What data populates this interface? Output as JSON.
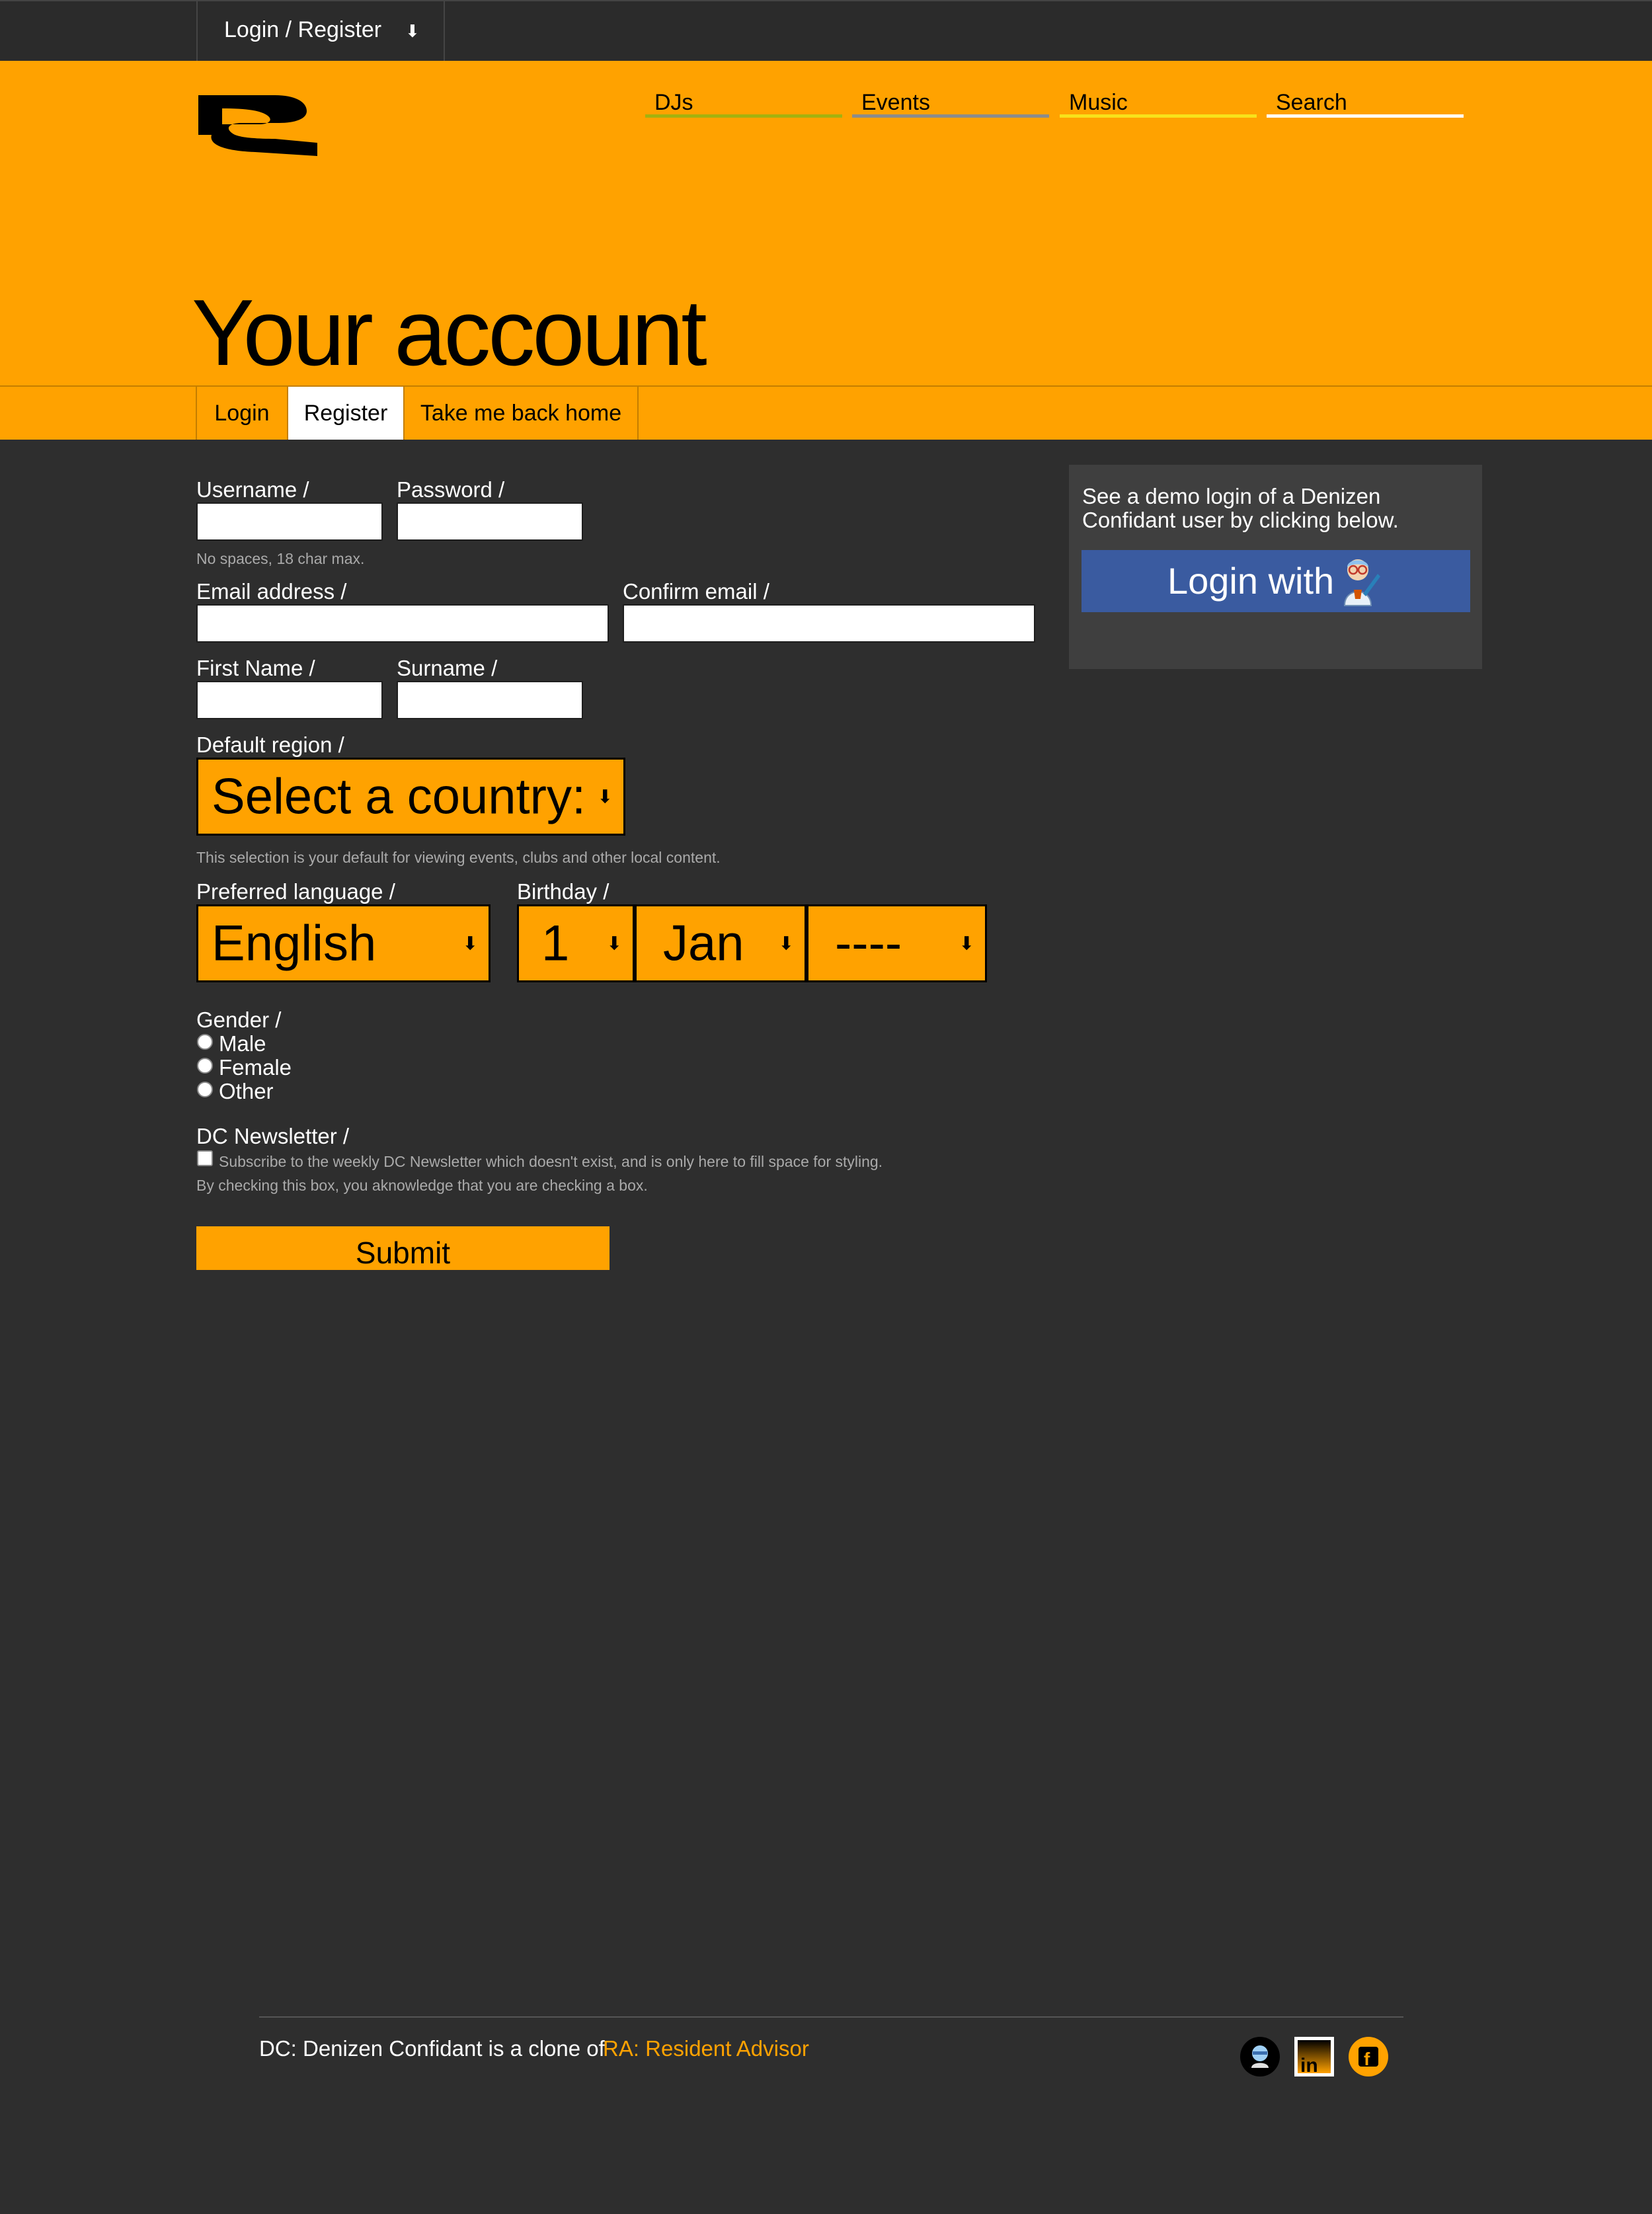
{
  "topbar": {
    "login_label": "Login / Register",
    "arrow": "⬇"
  },
  "nav": {
    "djs": "DJs",
    "events": "Events",
    "music": "Music",
    "search": "Search"
  },
  "colors": {
    "accent": "#ffa200",
    "djs_underline": "#a4b20e",
    "events_underline": "#8c8c8c",
    "music_underline": "#f7e21a",
    "search_underline": "#ffffff",
    "facebook_button": "#3a5ba0"
  },
  "page_title": "Your account",
  "tabs": {
    "login": "Login",
    "register": "Register",
    "home": "Take me back home"
  },
  "form": {
    "username_label": "Username /",
    "password_label": "Password /",
    "username_hint": "No spaces, 18 char max.",
    "email_label": "Email address /",
    "confirm_email_label": "Confirm email /",
    "first_name_label": "First Name /",
    "surname_label": "Surname /",
    "region_label": "Default region /",
    "region_value": "Select a country:",
    "region_hint": "This selection is your default for viewing events, clubs and other local content.",
    "language_label": "Preferred language /",
    "language_value": "English",
    "birthday_label": "Birthday /",
    "birthday_day": "1",
    "birthday_month": "Jan",
    "birthday_year": "----",
    "gender_label": "Gender /",
    "gender_male": "Male",
    "gender_female": "Female",
    "gender_other": "Other",
    "newsletter_label": "DC Newsletter /",
    "newsletter_text": "Subscribe to the weekly DC Newsletter which doesn't exist, and is only here to fill space for styling.",
    "newsletter_note": "By checking this box, you aknowledge that you are checking a box.",
    "submit_label": "Submit"
  },
  "demo": {
    "text": "See a demo login of a Denizen Confidant user by clicking below.",
    "button_label": "Login with"
  },
  "footer": {
    "text": "DC: Denizen Confidant is a clone of",
    "link": "RA: Resident Advisor",
    "icons": [
      "github-icon",
      "linkedin-icon",
      "facebook-icon"
    ]
  }
}
